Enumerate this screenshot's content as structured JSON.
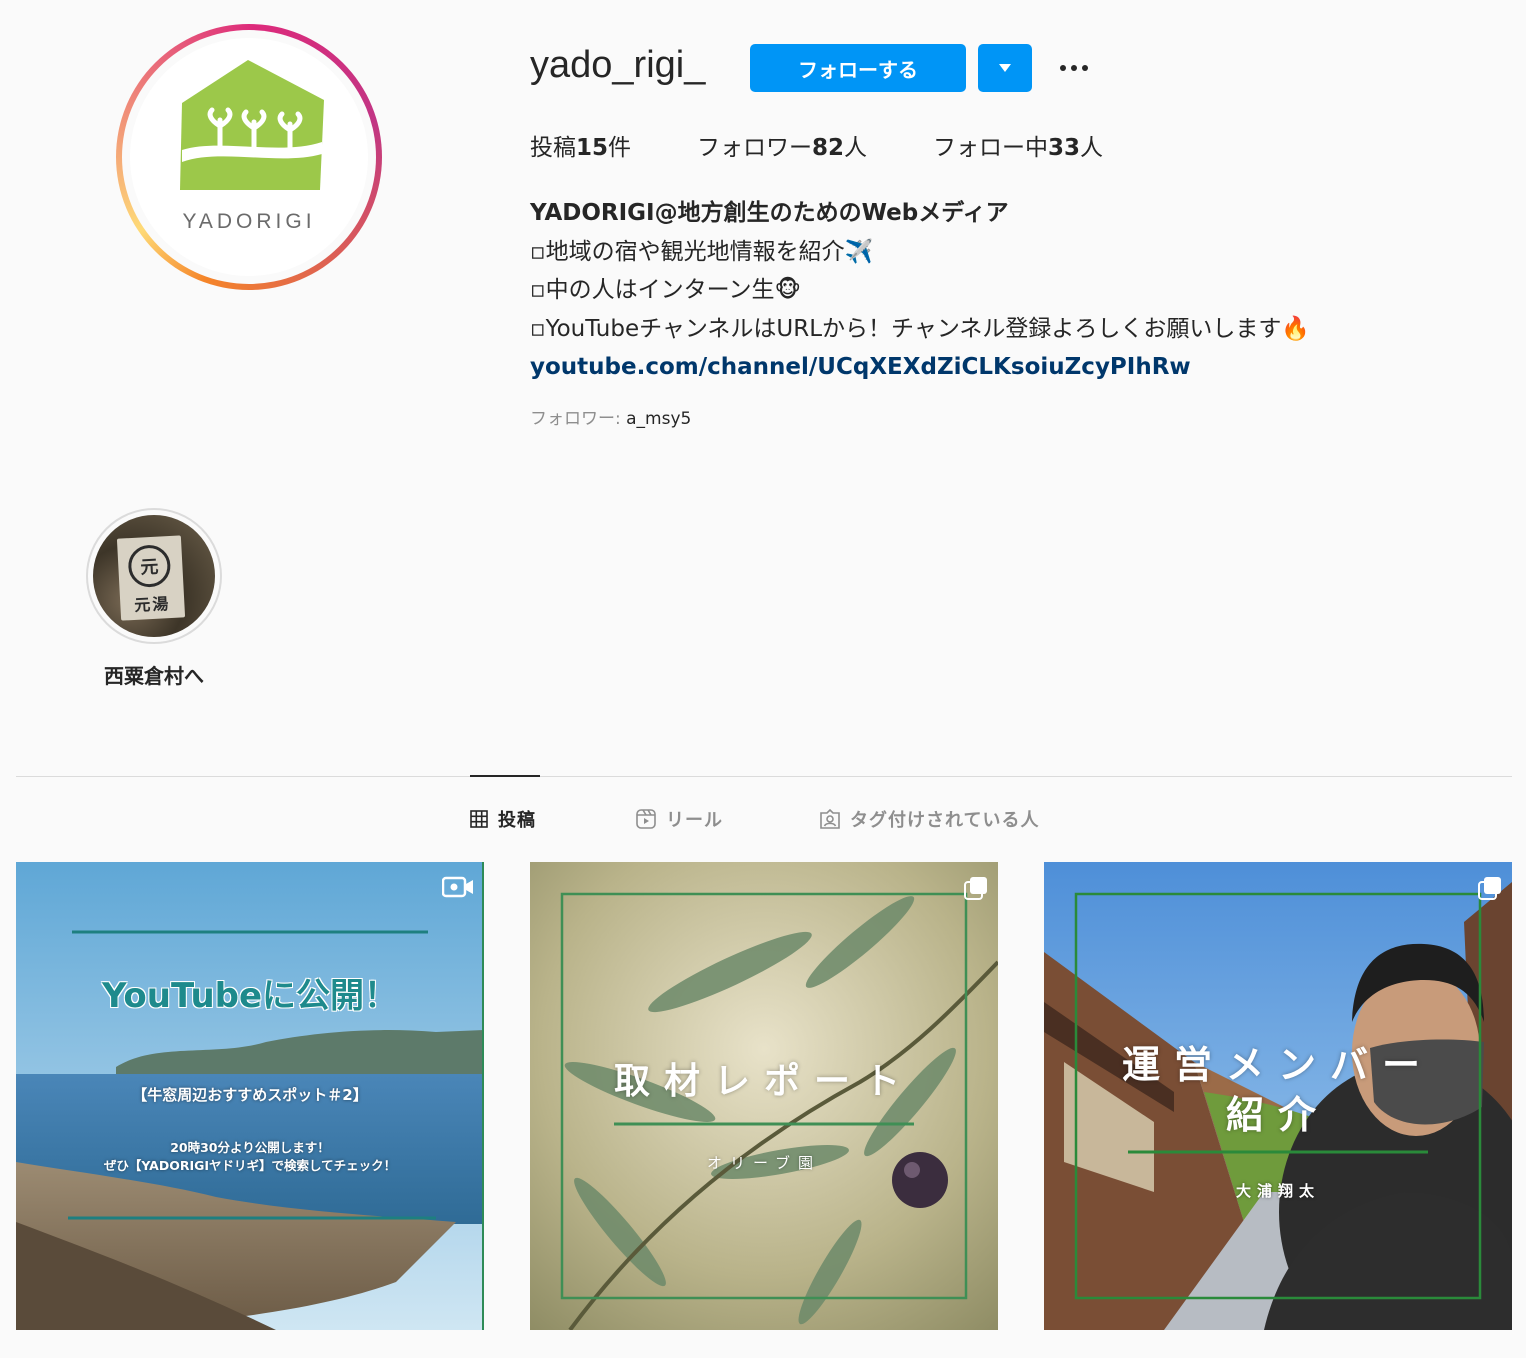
{
  "profile": {
    "username": "yado_rigi_",
    "follow_label": "フォローする",
    "avatar_wordmark": "YADORIGI",
    "stats": {
      "posts_label": "投稿",
      "posts_count": "15",
      "posts_unit": "件",
      "followers_label": "フォロワー",
      "followers_count": "82",
      "followers_unit": "人",
      "following_label": "フォロー中",
      "following_count": "33",
      "following_unit": "人"
    },
    "bio": {
      "name": "YADORIGI@地方創生のためのWebメディア",
      "line1": "▫地域の宿や観光地情報を紹介✈️",
      "line2": "▫中の人はインターン生🐵",
      "line3": "▫YouTubeチャンネルはURLから！チャンネル登録よろしくお願いします🔥",
      "link": "youtube.com/channel/UCqXEXdZiCLKsoiuZcyPIhRw"
    },
    "followed_by_label": "フォロワー: ",
    "followed_by_user": "a_msy5"
  },
  "highlights": [
    {
      "label": "西粟倉村へ",
      "sign_mark": "元",
      "sign_text": "元湯"
    }
  ],
  "tabs": [
    {
      "label": "投稿",
      "icon": "grid-icon",
      "active": true
    },
    {
      "label": "リール",
      "icon": "reels-icon",
      "active": false
    },
    {
      "label": "タグ付けされている人",
      "icon": "tagged-icon",
      "active": false
    }
  ],
  "posts": [
    {
      "type_icon": "video-icon",
      "title": "YouTubeに公開！",
      "subtitle": "【牛窓周辺おすすめスポット＃2】",
      "line2": "20時30分より公開します！",
      "line3": "ぜひ【YADORIGIヤドリギ】で検索してチェック！"
    },
    {
      "type_icon": "carousel-icon",
      "title": "取材レポート",
      "subtitle": "オリーブ園"
    },
    {
      "type_icon": "carousel-icon",
      "title_line1": "運営メンバー",
      "title_line2": "紹介",
      "subtitle": "大浦翔太"
    }
  ],
  "colors": {
    "follow_blue": "#0095f6",
    "link_blue": "#00376b",
    "logo_green": "#9cc84a",
    "teal_title": "#1e8a8c"
  }
}
